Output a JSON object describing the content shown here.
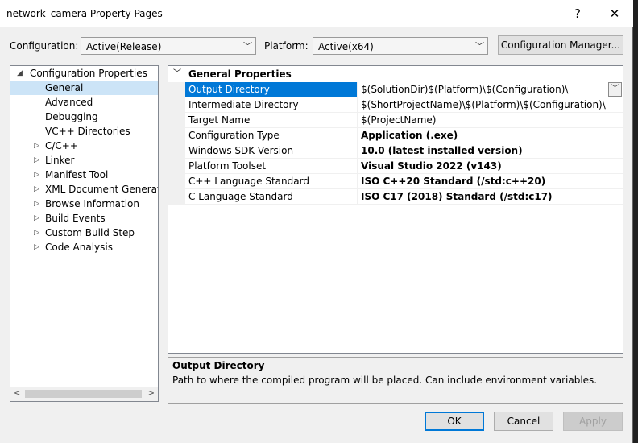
{
  "window": {
    "title": "network_camera Property Pages",
    "help_glyph": "?",
    "close_glyph": "✕"
  },
  "config_bar": {
    "configuration_label": "Configuration:",
    "configuration_value": "Active(Release)",
    "platform_label": "Platform:",
    "platform_value": "Active(x64)",
    "config_manager_label": "Configuration Manager..."
  },
  "tree": {
    "root": "Configuration Properties",
    "children": [
      {
        "label": "General",
        "expandable": false,
        "selected": true
      },
      {
        "label": "Advanced",
        "expandable": false
      },
      {
        "label": "Debugging",
        "expandable": false
      },
      {
        "label": "VC++ Directories",
        "expandable": false
      },
      {
        "label": "C/C++",
        "expandable": true
      },
      {
        "label": "Linker",
        "expandable": true
      },
      {
        "label": "Manifest Tool",
        "expandable": true
      },
      {
        "label": "XML Document Generator",
        "expandable": true
      },
      {
        "label": "Browse Information",
        "expandable": true
      },
      {
        "label": "Build Events",
        "expandable": true
      },
      {
        "label": "Custom Build Step",
        "expandable": true
      },
      {
        "label": "Code Analysis",
        "expandable": true
      }
    ]
  },
  "grid": {
    "category": "General Properties",
    "rows": [
      {
        "name": "Output Directory",
        "value": "$(SolutionDir)$(Platform)\\$(Configuration)\\",
        "bold": false,
        "selected": true
      },
      {
        "name": "Intermediate Directory",
        "value": "$(ShortProjectName)\\$(Platform)\\$(Configuration)\\",
        "bold": false
      },
      {
        "name": "Target Name",
        "value": "$(ProjectName)",
        "bold": false
      },
      {
        "name": "Configuration Type",
        "value": "Application (.exe)",
        "bold": true
      },
      {
        "name": "Windows SDK Version",
        "value": "10.0 (latest installed version)",
        "bold": true
      },
      {
        "name": "Platform Toolset",
        "value": "Visual Studio 2022 (v143)",
        "bold": true
      },
      {
        "name": "C++ Language Standard",
        "value": "ISO C++20 Standard (/std:c++20)",
        "bold": true
      },
      {
        "name": "C Language Standard",
        "value": "ISO C17 (2018) Standard (/std:c17)",
        "bold": true
      }
    ]
  },
  "description": {
    "title": "Output Directory",
    "text": "Path to where the compiled program will be placed. Can include environment variables."
  },
  "buttons": {
    "ok": "OK",
    "cancel": "Cancel",
    "apply": "Apply"
  }
}
